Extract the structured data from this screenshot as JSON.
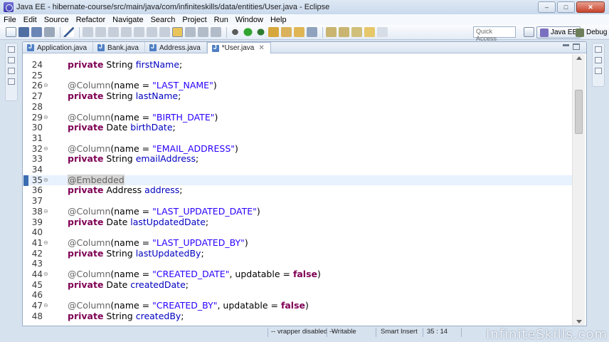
{
  "window": {
    "title": "Java EE - hibernate-course/src/main/java/com/infiniteskills/data/entities/User.java - Eclipse",
    "buttons": {
      "minimize": "–",
      "maximize": "□",
      "close": "✕"
    }
  },
  "menubar": {
    "items": [
      "File",
      "Edit",
      "Source",
      "Refactor",
      "Navigate",
      "Search",
      "Project",
      "Run",
      "Window",
      "Help"
    ]
  },
  "toolbar": {
    "quick_access_placeholder": "Quick Access",
    "perspectives": [
      {
        "label": "Java EE",
        "icon": "java-ee-perspective-icon",
        "active": true
      },
      {
        "label": "Debug",
        "icon": "debug-perspective-icon",
        "active": false
      }
    ]
  },
  "editor": {
    "tabs": [
      {
        "label": "Application.java",
        "active": false
      },
      {
        "label": "Bank.java",
        "active": false
      },
      {
        "label": "Address.java",
        "active": false
      },
      {
        "label": "*User.java",
        "active": true
      }
    ],
    "current_line": 35,
    "lines": [
      {
        "n": "24",
        "fold": false,
        "code": [
          [
            "kw",
            "private"
          ],
          [
            "t",
            " String "
          ],
          [
            "fld",
            "firstName"
          ],
          [
            "t",
            ";"
          ]
        ]
      },
      {
        "n": "25",
        "fold": false,
        "code": []
      },
      {
        "n": "26",
        "fold": true,
        "code": [
          [
            "ann",
            "@Column"
          ],
          [
            "t",
            "(name = "
          ],
          [
            "str",
            "\"LAST_NAME\""
          ],
          [
            "t",
            ")"
          ]
        ]
      },
      {
        "n": "27",
        "fold": false,
        "code": [
          [
            "kw",
            "private"
          ],
          [
            "t",
            " String "
          ],
          [
            "fld",
            "lastName"
          ],
          [
            "t",
            ";"
          ]
        ]
      },
      {
        "n": "28",
        "fold": false,
        "code": []
      },
      {
        "n": "29",
        "fold": true,
        "code": [
          [
            "ann",
            "@Column"
          ],
          [
            "t",
            "(name = "
          ],
          [
            "str",
            "\"BIRTH_DATE\""
          ],
          [
            "t",
            ")"
          ]
        ]
      },
      {
        "n": "30",
        "fold": false,
        "code": [
          [
            "kw",
            "private"
          ],
          [
            "t",
            " Date "
          ],
          [
            "fld",
            "birthDate"
          ],
          [
            "t",
            ";"
          ]
        ]
      },
      {
        "n": "31",
        "fold": false,
        "code": []
      },
      {
        "n": "32",
        "fold": true,
        "code": [
          [
            "ann",
            "@Column"
          ],
          [
            "t",
            "(name = "
          ],
          [
            "str",
            "\"EMAIL_ADDRESS\""
          ],
          [
            "t",
            ")"
          ]
        ]
      },
      {
        "n": "33",
        "fold": false,
        "code": [
          [
            "kw",
            "private"
          ],
          [
            "t",
            " String "
          ],
          [
            "fld",
            "emailAddress"
          ],
          [
            "t",
            ";"
          ]
        ]
      },
      {
        "n": "34",
        "fold": false,
        "code": []
      },
      {
        "n": "35",
        "fold": true,
        "code": [
          [
            "annocc",
            "@Embedded"
          ]
        ]
      },
      {
        "n": "36",
        "fold": false,
        "code": [
          [
            "kw",
            "private"
          ],
          [
            "t",
            " Address "
          ],
          [
            "fld",
            "address"
          ],
          [
            "t",
            ";"
          ]
        ]
      },
      {
        "n": "37",
        "fold": false,
        "code": []
      },
      {
        "n": "38",
        "fold": true,
        "code": [
          [
            "ann",
            "@Column"
          ],
          [
            "t",
            "(name = "
          ],
          [
            "str",
            "\"LAST_UPDATED_DATE\""
          ],
          [
            "t",
            ")"
          ]
        ]
      },
      {
        "n": "39",
        "fold": false,
        "code": [
          [
            "kw",
            "private"
          ],
          [
            "t",
            " Date "
          ],
          [
            "fld",
            "lastUpdatedDate"
          ],
          [
            "t",
            ";"
          ]
        ]
      },
      {
        "n": "40",
        "fold": false,
        "code": []
      },
      {
        "n": "41",
        "fold": true,
        "code": [
          [
            "ann",
            "@Column"
          ],
          [
            "t",
            "(name = "
          ],
          [
            "str",
            "\"LAST_UPDATED_BY\""
          ],
          [
            "t",
            ")"
          ]
        ]
      },
      {
        "n": "42",
        "fold": false,
        "code": [
          [
            "kw",
            "private"
          ],
          [
            "t",
            " String "
          ],
          [
            "fld",
            "lastUpdatedBy"
          ],
          [
            "t",
            ";"
          ]
        ]
      },
      {
        "n": "43",
        "fold": false,
        "code": []
      },
      {
        "n": "44",
        "fold": true,
        "code": [
          [
            "ann",
            "@Column"
          ],
          [
            "t",
            "(name = "
          ],
          [
            "str",
            "\"CREATED_DATE\""
          ],
          [
            "t",
            ", updatable = "
          ],
          [
            "kw",
            "false"
          ],
          [
            "t",
            ")"
          ]
        ]
      },
      {
        "n": "45",
        "fold": false,
        "code": [
          [
            "kw",
            "private"
          ],
          [
            "t",
            " Date "
          ],
          [
            "fld",
            "createdDate"
          ],
          [
            "t",
            ";"
          ]
        ]
      },
      {
        "n": "46",
        "fold": false,
        "code": []
      },
      {
        "n": "47",
        "fold": true,
        "code": [
          [
            "ann",
            "@Column"
          ],
          [
            "t",
            "(name = "
          ],
          [
            "str",
            "\"CREATED_BY\""
          ],
          [
            "t",
            ", updatable = "
          ],
          [
            "kw",
            "false"
          ],
          [
            "t",
            ")"
          ]
        ]
      },
      {
        "n": "48",
        "fold": false,
        "code": [
          [
            "kw",
            "private"
          ],
          [
            "t",
            " String "
          ],
          [
            "fld",
            "createdBy"
          ],
          [
            "t",
            ";"
          ]
        ]
      }
    ]
  },
  "statusbar": {
    "wrapper": "-- vrapper disabled --",
    "writable": "Writable",
    "insert_mode": "Smart Insert",
    "position": "35 : 14"
  },
  "watermark": "InfiniteSkills.com"
}
